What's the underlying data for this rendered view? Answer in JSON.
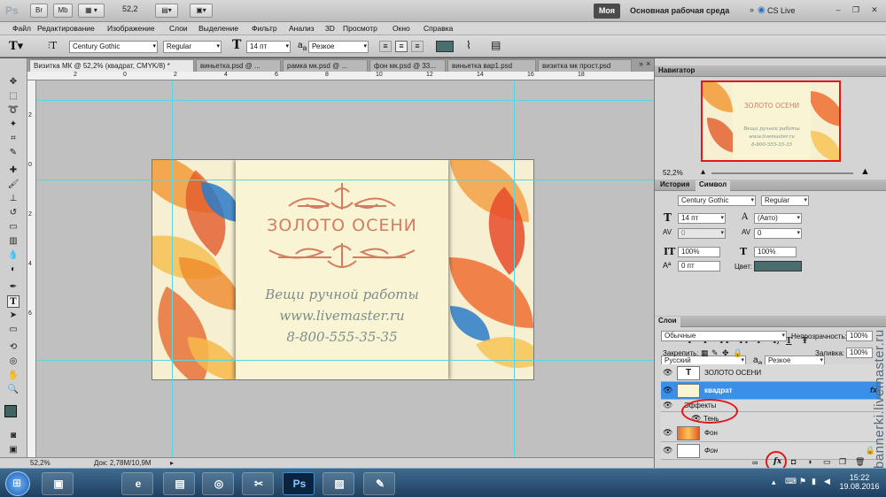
{
  "app": {
    "logo": "Ps",
    "zoom": "52,2",
    "workspace_btn": "Моя",
    "workspace_name": "Основная рабочая среда",
    "cs_live": "CS Live"
  },
  "topbar_buttons": [
    "Br",
    "Mb"
  ],
  "menu": [
    "Файл",
    "Редактирование",
    "Изображение",
    "Слои",
    "Выделение",
    "Фильтр",
    "Анализ",
    "3D",
    "Просмотр",
    "Окно",
    "Справка"
  ],
  "options": {
    "font_family": "Century Gothic",
    "font_style": "Regular",
    "font_size": "14 пт",
    "aa_prefix": "a",
    "aa_suffix": "a",
    "antialias": "Резкое",
    "color": "#4a6e6d"
  },
  "tabs": [
    "Визитка МК @ 52,2% (квадрат, CMYK/8) *",
    "виньетка.psd @ ...",
    "рамка мк.psd @ ...",
    "фон мк.psd @ 33...",
    "виньетка вар1.psd",
    "визитка мк прост.psd"
  ],
  "ruler_h": [
    "2",
    "0",
    "2",
    "4",
    "6",
    "8",
    "10",
    "12",
    "14",
    "16",
    "18"
  ],
  "ruler_v": [
    "2",
    "0",
    "2",
    "4",
    "6"
  ],
  "card": {
    "title": "ЗОЛОТО ОСЕНИ",
    "line1": "Вещи ручной работы",
    "line2": "www.livemaster.ru",
    "line3": "8-800-555-35-35",
    "title_color": "#d47c62",
    "text_color": "#7d8d8c"
  },
  "status": {
    "zoom": "52,2%",
    "doc": "Док: 2,78M/10,9M"
  },
  "navigator": {
    "title": "Навигатор",
    "zoom": "52,2%"
  },
  "char_panel": {
    "tab_history": "История",
    "tab_symbol": "Символ",
    "font_family": "Century Gothic",
    "font_style": "Regular",
    "size": "14 пт",
    "leading": "(Авто)",
    "kerning": "0",
    "tracking": "0",
    "vscale": "100%",
    "hscale": "100%",
    "baseline": "0 пт",
    "color_label": "Цвет:",
    "color": "#4a6e6d",
    "formats": [
      "T",
      "T",
      "TT",
      "Tт",
      "T¹",
      "T,",
      "T",
      "Ŧ"
    ],
    "language": "Русский",
    "aa_prefix": "a",
    "aa_suffix": "a",
    "antialias": "Резкое"
  },
  "layers_panel": {
    "title": "Слои",
    "blend": "Обычные",
    "opacity_label": "Непрозрачность:",
    "opacity": "100%",
    "lock_label": "Закрепить:",
    "fill_label": "Заливка:",
    "fill": "100%",
    "layers": [
      {
        "name": "ЗОЛОТО ОСЕНИ",
        "thumb": "T"
      },
      {
        "name": "квадрат",
        "fx": "fx"
      },
      {
        "name": "Эффекты"
      },
      {
        "name": "Тень"
      },
      {
        "name": "Фон"
      },
      {
        "name": "Фон"
      }
    ],
    "fx_button": "fx"
  },
  "watermark": "bannerki.livemaster.ru",
  "taskbar": {
    "ps_label": "Ps",
    "time": "15:22",
    "date": "19.08.2016"
  }
}
